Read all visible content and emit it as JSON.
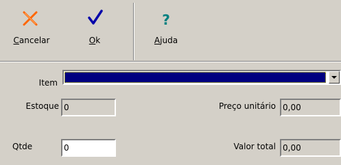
{
  "toolbar": {
    "cancel": {
      "label": "Cancelar",
      "accel": "C",
      "rest": "ancelar",
      "icon": "x-icon",
      "color": "#ff6600"
    },
    "ok": {
      "label": "Ok",
      "accel": "O",
      "rest": "k",
      "icon": "checkmark-icon",
      "color": "#0000aa"
    },
    "help": {
      "label": "Ajuda",
      "accel": "A",
      "rest": "juda",
      "icon": "question-icon",
      "color": "#008080"
    }
  },
  "form": {
    "item_label": "Item",
    "item_value": "",
    "estoque_label": "Estoque",
    "estoque_value": "0",
    "qtde_label": "Qtde",
    "qtde_value": "0",
    "preco_label": "Preço unitário",
    "preco_value": "0,00",
    "valor_label": "Valor total",
    "valor_value": "0,00"
  },
  "colors": {
    "background": "#d4d0c8",
    "selection": "#000080"
  }
}
